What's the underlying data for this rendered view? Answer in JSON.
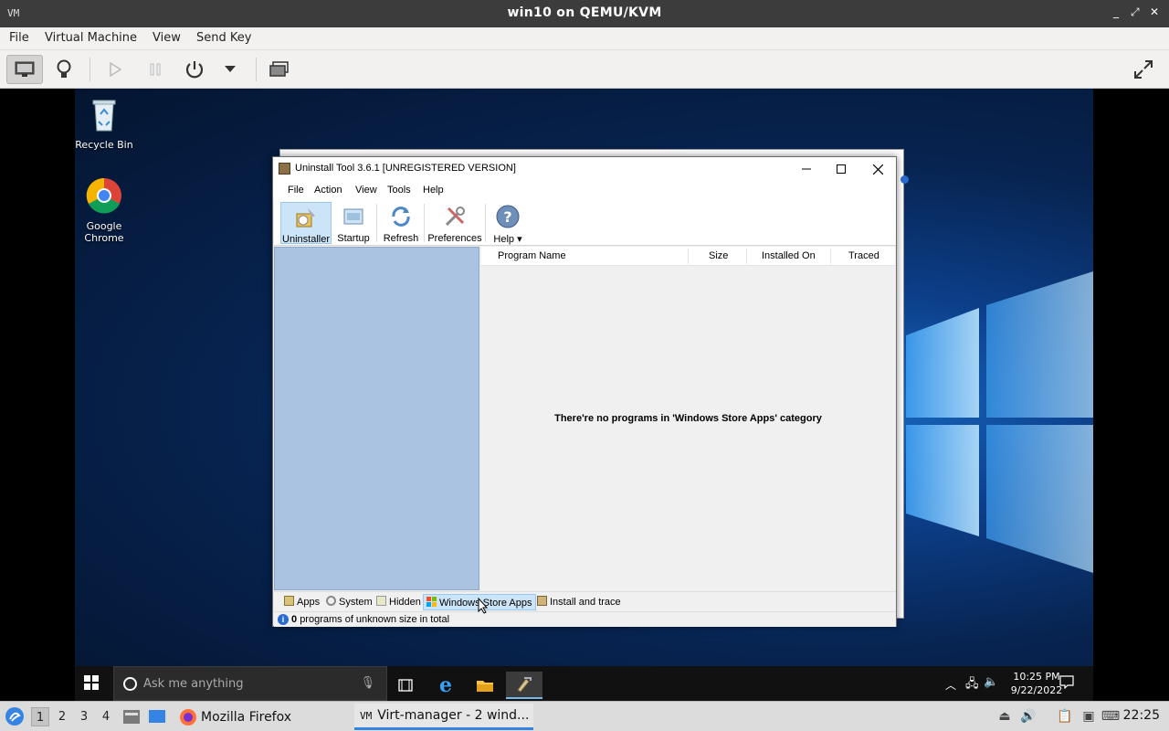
{
  "host": {
    "window_title": "win10 on QEMU/KVM",
    "app_icon": "VM",
    "menu": [
      "File",
      "Virtual Machine",
      "View",
      "Send Key"
    ],
    "window_controls": [
      "_",
      "⤢",
      "✕"
    ]
  },
  "desktop": {
    "icons": [
      {
        "label": "Recycle Bin"
      },
      {
        "label": "Google Chrome"
      }
    ]
  },
  "uninstall_tool": {
    "title": "Uninstall Tool 3.6.1 [UNREGISTERED VERSION]",
    "menu": [
      "File",
      "Action",
      "View",
      "Tools",
      "Help"
    ],
    "toolbar": {
      "uninstaller": "Uninstaller",
      "startup": "Startup",
      "refresh": "Refresh",
      "preferences": "Preferences",
      "help": "Help ▾"
    },
    "columns": {
      "program_name": "Program Name",
      "size": "Size",
      "installed_on": "Installed On",
      "traced": "Traced"
    },
    "empty_message": "There're no programs in 'Windows Store Apps' category",
    "tabs": {
      "apps": "Apps",
      "system": "System",
      "hidden": "Hidden",
      "store": "Windows Store Apps",
      "install_trace": "Install and trace"
    },
    "status": {
      "count": "0",
      "text": "programs of unknown size in total"
    }
  },
  "win_taskbar": {
    "search_placeholder": "Ask me anything",
    "time": "10:25 PM",
    "date": "9/22/2022"
  },
  "host_taskbar": {
    "workspaces": [
      "1",
      "2",
      "3",
      "4"
    ],
    "tasks": {
      "firefox": "Mozilla Firefox",
      "virt": "Virt-manager - 2 wind..."
    },
    "clock": "22:25"
  },
  "colors": {
    "host_titlebar": "#3c3c3c",
    "accent": "#3584e4",
    "ut_left_panel": "#a9c3e0",
    "ut_selected": "#cce4f7"
  }
}
